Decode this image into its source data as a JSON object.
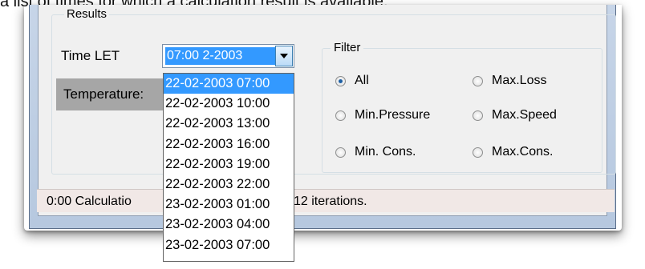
{
  "caption": {
    "text": "a list of times for which a calculation result is available."
  },
  "results": {
    "title": "Results"
  },
  "time": {
    "label": "Time LET",
    "selected_value": "2-2003 07:00",
    "options": [
      "22-02-2003 07:00",
      "22-02-2003 10:00",
      "22-02-2003 13:00",
      "22-02-2003 16:00",
      "22-02-2003 19:00",
      "22-02-2003 22:00",
      "23-02-2003 01:00",
      "23-02-2003 04:00",
      "23-02-2003 07:00"
    ],
    "selected_index": 0
  },
  "temperature": {
    "label": "Temperature:"
  },
  "filter": {
    "title": "Filter",
    "options": [
      {
        "label": "All",
        "checked": true
      },
      {
        "label": "Max.Loss",
        "checked": false
      },
      {
        "label": "Min.Pressure",
        "checked": false
      },
      {
        "label": "Max.Speed",
        "checked": false
      },
      {
        "label": "Min. Cons.",
        "checked": false
      },
      {
        "label": "Max.Cons.",
        "checked": false
      }
    ]
  },
  "status": {
    "prefix": "0:00 Calculatio",
    "suffix": "12 iterations."
  },
  "colors": {
    "selection": "#3399ff",
    "window_frame": "#c7d5e8",
    "status_bg": "#f1e8e6"
  }
}
